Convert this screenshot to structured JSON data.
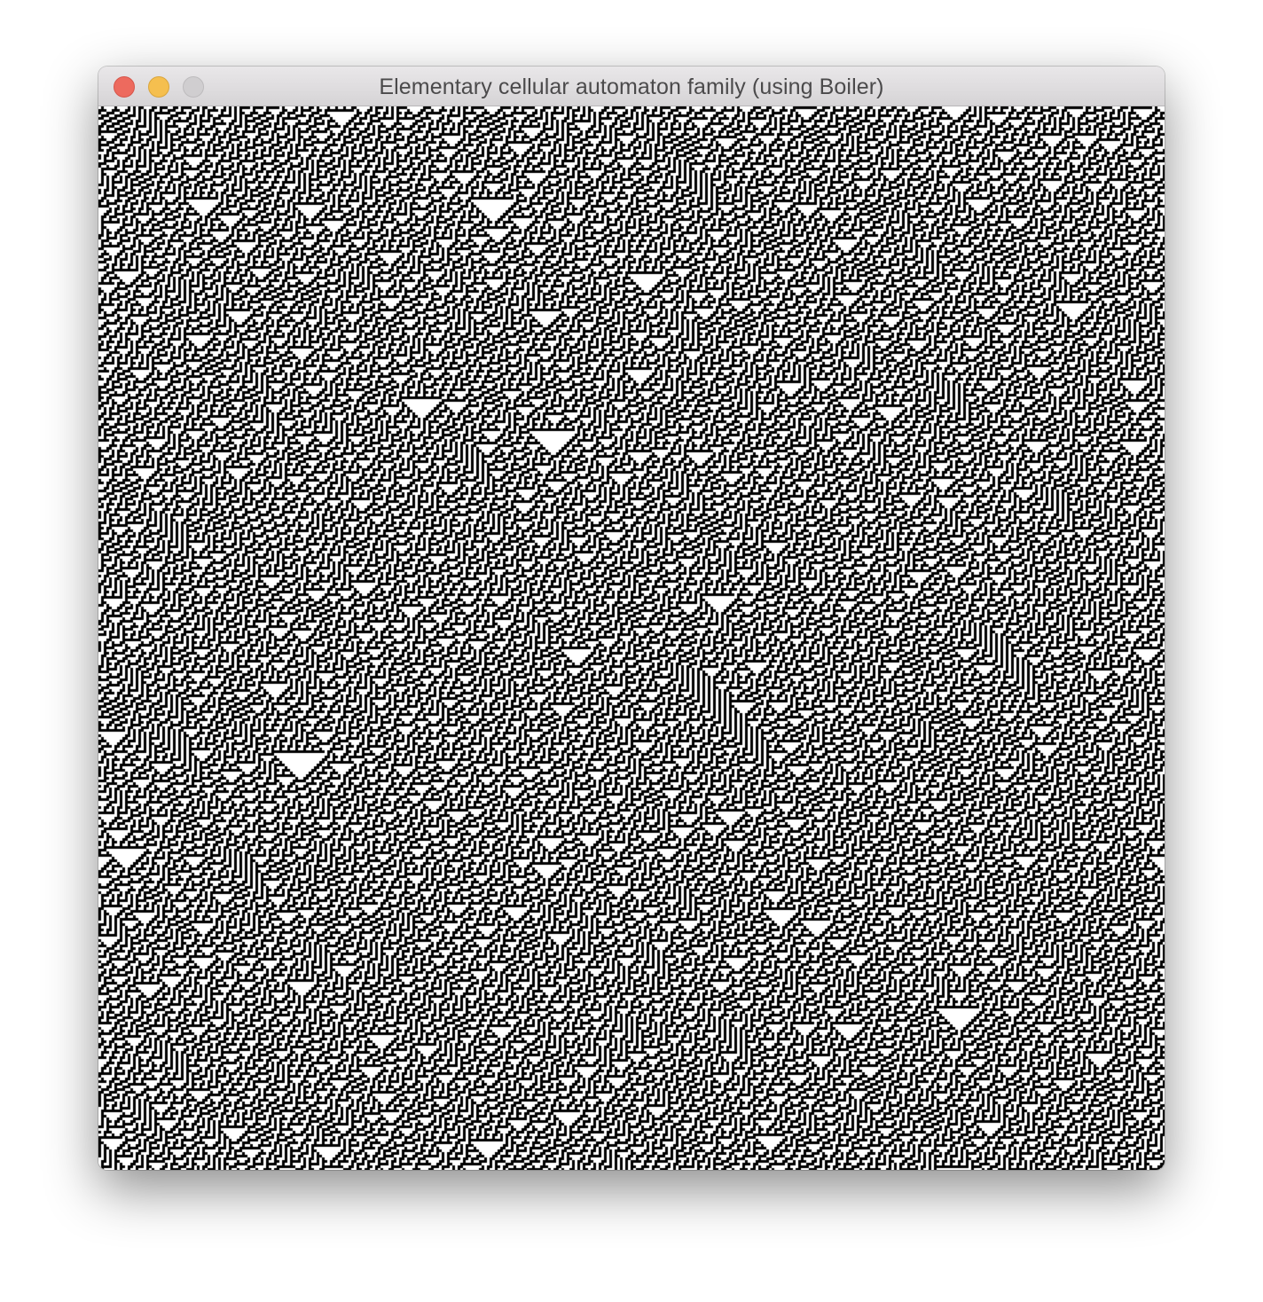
{
  "window": {
    "title": "Elementary cellular automaton family (using Boiler)",
    "buttons": {
      "close_icon": "close-icon",
      "minimize_icon": "minimize-icon",
      "zoom_icon": "zoom-icon"
    },
    "colors": {
      "close": "#ed6a5e",
      "minimize": "#f5bf4f",
      "zoom_disabled": "#d0ced0",
      "cell_alive": "#000000",
      "cell_dead": "#ffffff"
    }
  }
}
